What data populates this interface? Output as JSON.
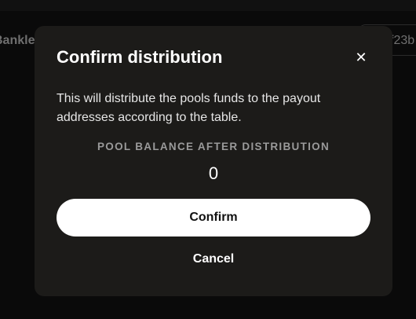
{
  "background": {
    "brand_text": "Bankle",
    "address_text": "f23b"
  },
  "modal": {
    "title": "Confirm distribution",
    "close_icon": "close-icon",
    "description": "This will distribute the pools funds to the payout addresses according to the table.",
    "balance_label": "POOL BALANCE AFTER DISTRIBUTION",
    "balance_value": "0",
    "confirm_label": "Confirm",
    "cancel_label": "Cancel"
  },
  "colors": {
    "modal_background": "#1c1b19",
    "confirm_button": "#ffffff",
    "page_background": "#0a0a0a"
  }
}
